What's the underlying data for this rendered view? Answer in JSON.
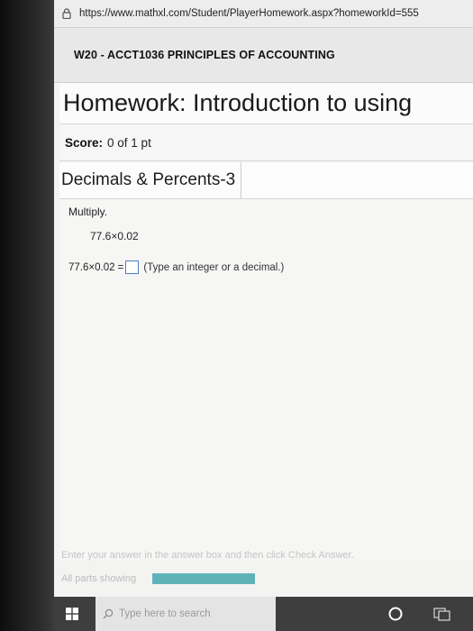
{
  "browser": {
    "url": "https://www.mathxl.com/Student/PlayerHomework.aspx?homeworkId=555"
  },
  "course": {
    "title": "W20 - ACCT1036 PRINCIPLES OF ACCOUNTING"
  },
  "homework": {
    "title": "Homework: Introduction to using"
  },
  "score": {
    "label": "Score:",
    "value": "0 of 1 pt"
  },
  "section": {
    "title": "Decimals & Percents-3"
  },
  "question": {
    "instruction": "Multiply.",
    "expression": "77.6×0.02",
    "answer_prefix": "77.6×0.02 =",
    "answer_value": "",
    "answer_hint": "(Type an integer or a decimal.)"
  },
  "footer": {
    "hint": "Enter your answer in the answer box and then click Check Answer.",
    "parts_label": "All parts showing",
    "progress_fraction": 1.0
  },
  "taskbar": {
    "search_placeholder": "Type here to search"
  },
  "icons": {
    "lock": "lock-icon",
    "windows": "windows-start-icon",
    "search": "search-icon",
    "cortana": "cortana-icon",
    "taskview": "task-view-icon"
  },
  "colors": {
    "answer_box_border": "#4a7fc0",
    "progress_fill": "#5fb3b8",
    "taskbar": "#3e3e3f"
  }
}
